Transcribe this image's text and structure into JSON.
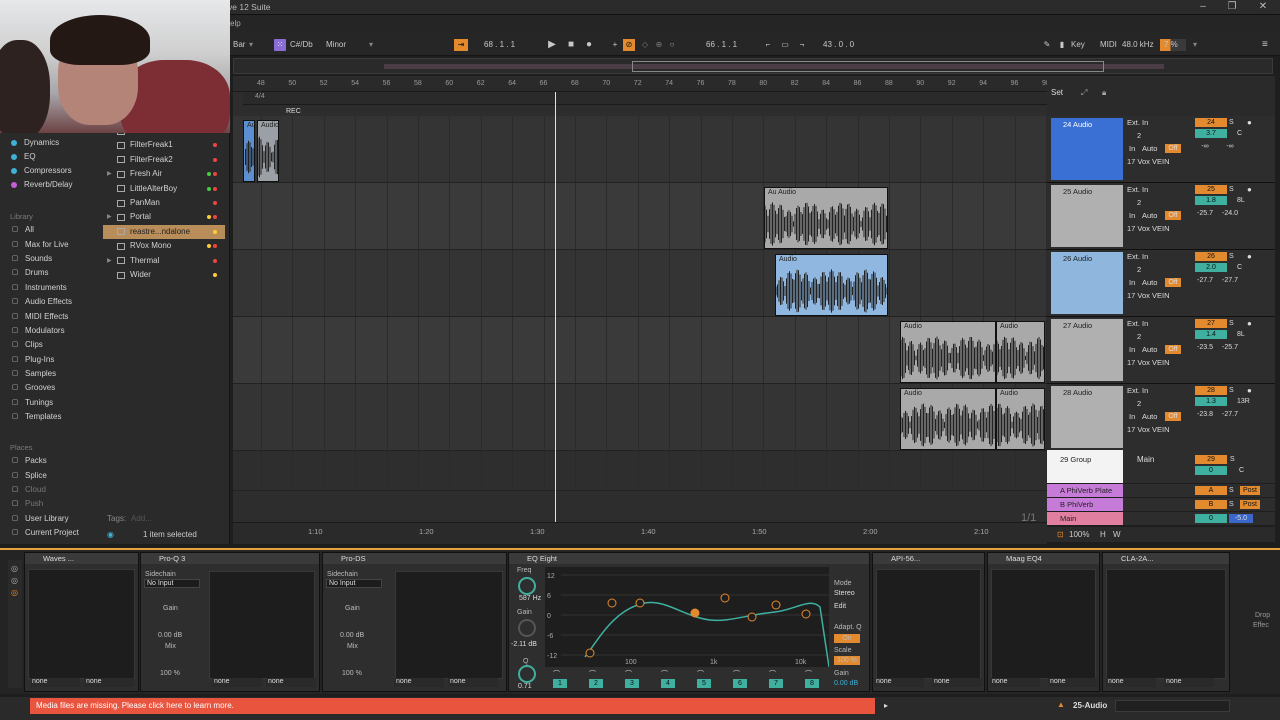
{
  "window": {
    "title": "ve 12 Suite",
    "minimize": "–",
    "maximize": "❐",
    "close": "✕"
  },
  "menu": {
    "partial": "elp"
  },
  "control_bar": {
    "bar_label": "Bar",
    "scale_root": "C#/Db",
    "scale_mode": "Minor",
    "position": "68 . 1 . 1",
    "loop_start": "66 . 1 . 1",
    "loop_length": "43 . 0 . 0",
    "key_label": "Key",
    "midi_label": "MIDI",
    "sample_rate": "48.0 kHz",
    "cpu": "7 %",
    "colors": {
      "accent": "#e38a2e",
      "scale": "#8a6cd6"
    }
  },
  "browser": {
    "categories_top": [
      "Dynamics",
      "EQ",
      "Compressors",
      "Reverb/Delay"
    ],
    "category_colors": [
      "#3fb0d6",
      "#3fb0d6",
      "#3fb0d6",
      "#c25fd3"
    ],
    "library_header": "Library",
    "library": [
      {
        "label": "All",
        "icon": "▢"
      },
      {
        "label": "Max for Live",
        "icon": "▢"
      },
      {
        "label": "Sounds",
        "icon": "▢"
      },
      {
        "label": "Drums",
        "icon": "▢"
      },
      {
        "label": "Instruments",
        "icon": "▢"
      },
      {
        "label": "Audio Effects",
        "icon": "▢"
      },
      {
        "label": "MIDI Effects",
        "icon": "▢"
      },
      {
        "label": "Modulators",
        "icon": "▢"
      },
      {
        "label": "Clips",
        "icon": "▢"
      },
      {
        "label": "Plug-Ins",
        "icon": "▢"
      },
      {
        "label": "Samples",
        "icon": "▢"
      },
      {
        "label": "Grooves",
        "icon": "▢"
      },
      {
        "label": "Tunings",
        "icon": "▢"
      },
      {
        "label": "Templates",
        "icon": "▢"
      }
    ],
    "places_header": "Places",
    "places": [
      "Packs",
      "Splice",
      "Cloud",
      "Push",
      "User Library",
      "Current Project"
    ],
    "fx_list": [
      {
        "label": "Endless Smile 64",
        "colors": []
      },
      {
        "label": "FilterFreak1",
        "colors": [
          "#e44"
        ]
      },
      {
        "label": "FilterFreak2",
        "colors": [
          "#e44"
        ]
      },
      {
        "label": "Fresh Air",
        "colors": [
          "#e44",
          "#4c4"
        ]
      },
      {
        "label": "LittleAlterBoy",
        "colors": [
          "#e44",
          "#4c4"
        ]
      },
      {
        "label": "PanMan",
        "colors": [
          "#e44"
        ]
      },
      {
        "label": "Portal",
        "colors": [
          "#e44",
          "#fc3"
        ]
      },
      {
        "label": "reastre...ndalone",
        "colors": [
          "#fc3"
        ]
      },
      {
        "label": "RVox Mono",
        "colors": [
          "#e44",
          "#fc3"
        ]
      },
      {
        "label": "Thermal",
        "colors": [
          "#e44"
        ]
      },
      {
        "label": "Wider",
        "colors": [
          "#fc3"
        ]
      }
    ],
    "tags_label": "Tags:",
    "tags_placeholder": "Add...",
    "selection": "1 item selected"
  },
  "arrangement": {
    "bars": [
      "48",
      "50",
      "52",
      "54",
      "56",
      "58",
      "60",
      "62",
      "64",
      "66",
      "68",
      "70",
      "72",
      "74",
      "76",
      "78",
      "80",
      "82",
      "84",
      "86",
      "88",
      "90",
      "92",
      "94",
      "96",
      "98"
    ],
    "times": [
      "1:10",
      "1:20",
      "1:30",
      "1:40",
      "1:50",
      "2:00",
      "2:10"
    ],
    "top_marker": "REC",
    "meter": "4/4",
    "page": "1/1",
    "clips": [
      {
        "label": "Au",
        "color": "#5c8fd0"
      },
      {
        "label": "Audio",
        "color": "#9ba0a6"
      },
      {
        "label": "Au Audio",
        "color": "#a9a9a9"
      },
      {
        "label": "Audio",
        "color": "#90b7df"
      },
      {
        "label": "Audio",
        "color": "#a9a9a9"
      },
      {
        "label": "Audio",
        "color": "#a9a9a9"
      },
      {
        "label": "Audio",
        "color": "#a9a9a9"
      },
      {
        "label": "Audio",
        "color": "#a9a9a9"
      }
    ]
  },
  "tracks": [
    {
      "name": "24 Audio",
      "color": "#3a6fd4",
      "num": "24",
      "vol": "3.7",
      "pan": "C",
      "send1": "-∞",
      "send2": "-∞",
      "input": "Ext. In",
      "ch": "2",
      "out": "17 Vox VEIN"
    },
    {
      "name": "25 Audio",
      "color": "#b0b0b0",
      "num": "25",
      "vol": "1.8",
      "pan": "8L",
      "send1": "-25.7",
      "send2": "-24.0",
      "input": "Ext. In",
      "ch": "2",
      "out": "17 Vox VEIN"
    },
    {
      "name": "26 Audio",
      "color": "#8fb6dd",
      "num": "26",
      "vol": "2.0",
      "pan": "C",
      "send1": "-27.7",
      "send2": "-27.7",
      "input": "Ext. In",
      "ch": "2",
      "out": "17 Vox VEIN"
    },
    {
      "name": "27 Audio",
      "color": "#b0b0b0",
      "num": "27",
      "vol": "1.4",
      "pan": "8L",
      "send1": "-23.5",
      "send2": "-25.7",
      "input": "Ext. In",
      "ch": "2",
      "out": "17 Vox VEIN"
    },
    {
      "name": "28 Audio",
      "color": "#b0b0b0",
      "num": "28",
      "vol": "1.3",
      "pan": "13R",
      "send1": "-23.8",
      "send2": "-27.7",
      "input": "Ext. In",
      "ch": "2",
      "out": "17 Vox VEIN"
    }
  ],
  "group": {
    "name": "29 Group",
    "out": "Main",
    "num": "29",
    "vol": "0",
    "pan": "C"
  },
  "returns": [
    {
      "name": "A PhiVerb Plate",
      "letter": "A",
      "color": "#c77bd8"
    },
    {
      "name": "B PhiVerb",
      "letter": "B",
      "color": "#c77bd8"
    },
    {
      "name": "Main",
      "letter": "1/2",
      "color": "#e07fa0"
    }
  ],
  "mixer_labels": {
    "in": "In",
    "auto": "Auto",
    "off": "Off",
    "s": "S",
    "post": "Post",
    "zoom": "100%",
    "h": "H",
    "w": "W",
    "set": "Set",
    "main_vol": "-5.0",
    "main_ret": "0"
  },
  "devices": [
    {
      "name": "Waves ..."
    },
    {
      "name": "Pro-Q 3",
      "sidechain": "Sidechain",
      "input": "No Input",
      "gain": "Gain",
      "gain_val": "0.00 dB",
      "mix": "Mix",
      "mix_val": "100 %",
      "mute": "Mute"
    },
    {
      "name": "Pro-DS",
      "sidechain": "Sidechain",
      "input": "No Input",
      "gain": "Gain",
      "gain_val": "0.00 dB",
      "mix": "Mix",
      "mix_val": "100 %",
      "mute": "Mute"
    },
    {
      "name": "EQ Eight",
      "freq": "Freq",
      "freq_val": "587 Hz",
      "gain": "Gain",
      "gain_val": "-2.11 dB",
      "q": "Q",
      "q_val": "0.71",
      "mode": "Mode",
      "mode_val": "Stereo",
      "edit": "Edit",
      "adapt": "Adapt. Q",
      "adapt_val": "On",
      "scale": "Scale",
      "scale_val": "100 %",
      "out_gain": "Gain",
      "out_gain_val": "0.00 dB",
      "db_ticks": [
        "12",
        "6",
        "0",
        "-6",
        "-12"
      ],
      "freq_ticks": [
        "100",
        "1k",
        "10k"
      ],
      "bands": [
        "1",
        "2",
        "3",
        "4",
        "5",
        "6",
        "7",
        "8"
      ]
    },
    {
      "name": "API-56..."
    },
    {
      "name": "Maag EQ4"
    },
    {
      "name": "CLA-2A..."
    }
  ],
  "device_none": "none",
  "right_panel": {
    "line1": "Drop",
    "line2": "Effec"
  },
  "status": {
    "error": "Media files are missing. Please click here to learn more.",
    "track": "25-Audio"
  }
}
